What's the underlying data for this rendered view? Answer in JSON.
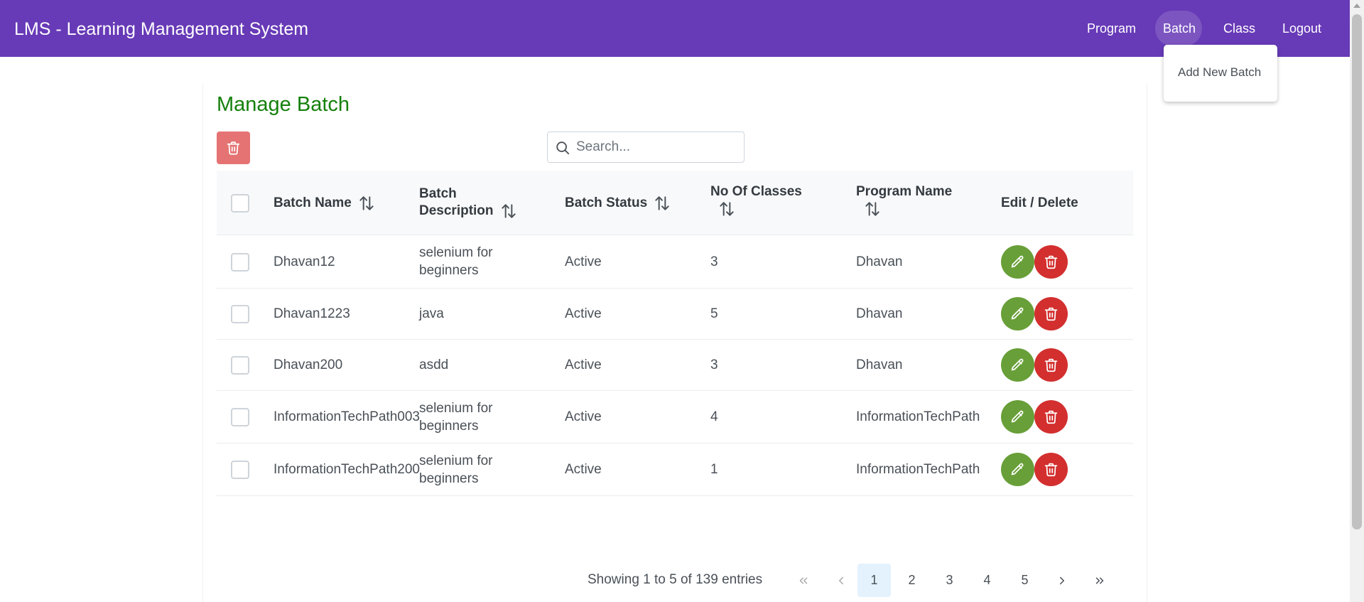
{
  "header": {
    "title": "LMS - Learning Management System",
    "nav": [
      "Program",
      "Batch",
      "Class",
      "Logout"
    ],
    "active_nav": "Batch",
    "bar_color": "#673ab7"
  },
  "dropdown": {
    "item": "Add New Batch"
  },
  "page": {
    "title": "Manage Batch",
    "title_color": "#14800b",
    "search_placeholder": "Search..."
  },
  "table": {
    "columns": [
      "Batch Name",
      "Batch Description",
      "Batch Status",
      "No Of Classes",
      "Program Name",
      "Edit / Delete"
    ],
    "column_lines": {
      "batch_description": [
        "Batch",
        "Description"
      ],
      "no_of_classes": "No Of Classes",
      "program_name": "Program Name"
    },
    "rows": [
      {
        "name": "Dhavan12",
        "description": [
          "selenium for",
          "beginners"
        ],
        "status": "Active",
        "classes": "3",
        "program": "Dhavan"
      },
      {
        "name": "Dhavan1223",
        "description": [
          "java"
        ],
        "status": "Active",
        "classes": "5",
        "program": "Dhavan"
      },
      {
        "name": "Dhavan200",
        "description": [
          "asdd"
        ],
        "status": "Active",
        "classes": "3",
        "program": "Dhavan"
      },
      {
        "name": "InformationTechPath003",
        "description": [
          "selenium for",
          "beginners"
        ],
        "status": "Active",
        "classes": "4",
        "program": "InformationTechPath"
      },
      {
        "name": "InformationTechPath200",
        "description": [
          "selenium for",
          "beginners"
        ],
        "status": "Active",
        "classes": "1",
        "program": "InformationTechPath"
      }
    ]
  },
  "paginator": {
    "report": "Showing 1 to 5 of 139 entries",
    "pages": [
      "1",
      "2",
      "3",
      "4",
      "5"
    ],
    "current": "1"
  },
  "icons": {
    "bulk_delete": "trash-icon",
    "search": "search-icon",
    "sort": "sort-alt-icon",
    "edit": "pencil-icon",
    "delete": "trash-icon",
    "first": "angle-double-left-icon",
    "prev": "angle-left-icon",
    "next": "angle-right-icon",
    "last": "angle-double-right-icon"
  },
  "colors": {
    "edit_button": "#689f38",
    "delete_button": "#d32f2f",
    "bulk_delete_button": "#e57373"
  }
}
